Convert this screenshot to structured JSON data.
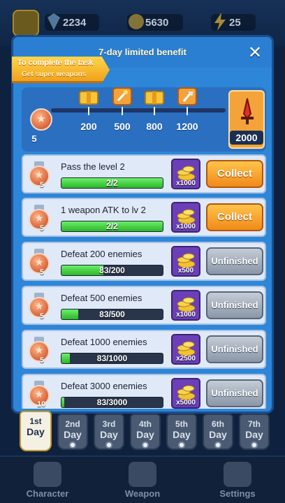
{
  "topbar": {
    "resources": [
      {
        "icon": "hero-avatar-icon",
        "value": "2234"
      },
      {
        "icon": "gold-coin-icon",
        "value": "5630"
      },
      {
        "icon": "energy-bolt-icon",
        "value": "25"
      }
    ]
  },
  "panel": {
    "title": "7-day limited benefit",
    "ribbon_line1": "To complete the task",
    "ribbon_line2": "Get super weapons",
    "current_points": "5",
    "milestones": [
      {
        "value": "200",
        "reward_icon": "treasure-chest-icon"
      },
      {
        "value": "500",
        "reward_icon": "weapon-scroll-icon"
      },
      {
        "value": "800",
        "reward_icon": "treasure-chest-icon"
      },
      {
        "value": "1200",
        "reward_icon": "axe-weapon-icon"
      }
    ],
    "grand_reward": {
      "value": "2000",
      "icon": "red-sword-icon"
    }
  },
  "tasks": [
    {
      "name": "Pass the level 2",
      "progress_text": "2/2",
      "progress": 1.0,
      "medal": "5",
      "reward": "x1000",
      "button": "Collect",
      "state": "collect"
    },
    {
      "name": "1 weapon ATK to lv 2",
      "progress_text": "2/2",
      "progress": 1.0,
      "medal": "5",
      "reward": "x1000",
      "button": "Collect",
      "state": "collect"
    },
    {
      "name": "Defeat 200 enemies",
      "progress_text": "83/200",
      "progress": 0.415,
      "medal": "5",
      "reward": "x500",
      "button": "Unfinished",
      "state": "unfinished"
    },
    {
      "name": "Defeat 500 enemies",
      "progress_text": "83/500",
      "progress": 0.166,
      "medal": "5",
      "reward": "x1000",
      "button": "Unfinished",
      "state": "unfinished"
    },
    {
      "name": "Defeat 1000 enemies",
      "progress_text": "83/1000",
      "progress": 0.083,
      "medal": "5",
      "reward": "x2500",
      "button": "Unfinished",
      "state": "unfinished"
    },
    {
      "name": "Defeat 3000 enemies",
      "progress_text": "83/3000",
      "progress": 0.028,
      "medal": "10",
      "reward": "x5000",
      "button": "Unfinished",
      "state": "unfinished"
    }
  ],
  "days": [
    {
      "num": "1st",
      "label": "Day",
      "active": true
    },
    {
      "num": "2nd",
      "label": "Day",
      "active": false
    },
    {
      "num": "3rd",
      "label": "Day",
      "active": false
    },
    {
      "num": "4th",
      "label": "Day",
      "active": false
    },
    {
      "num": "5th",
      "label": "Day",
      "active": false
    },
    {
      "num": "6th",
      "label": "Day",
      "active": false
    },
    {
      "num": "7th",
      "label": "Day",
      "active": false
    }
  ],
  "bottom_nav": [
    {
      "label": "Character",
      "icon": "character-icon"
    },
    {
      "label": "Weapon",
      "icon": "sword-icon"
    },
    {
      "label": "Settings",
      "icon": "gear-icon"
    }
  ],
  "colors": {
    "accent": "#2e86d8",
    "collect": "#f08a1a",
    "progress": "#2cb52a"
  }
}
